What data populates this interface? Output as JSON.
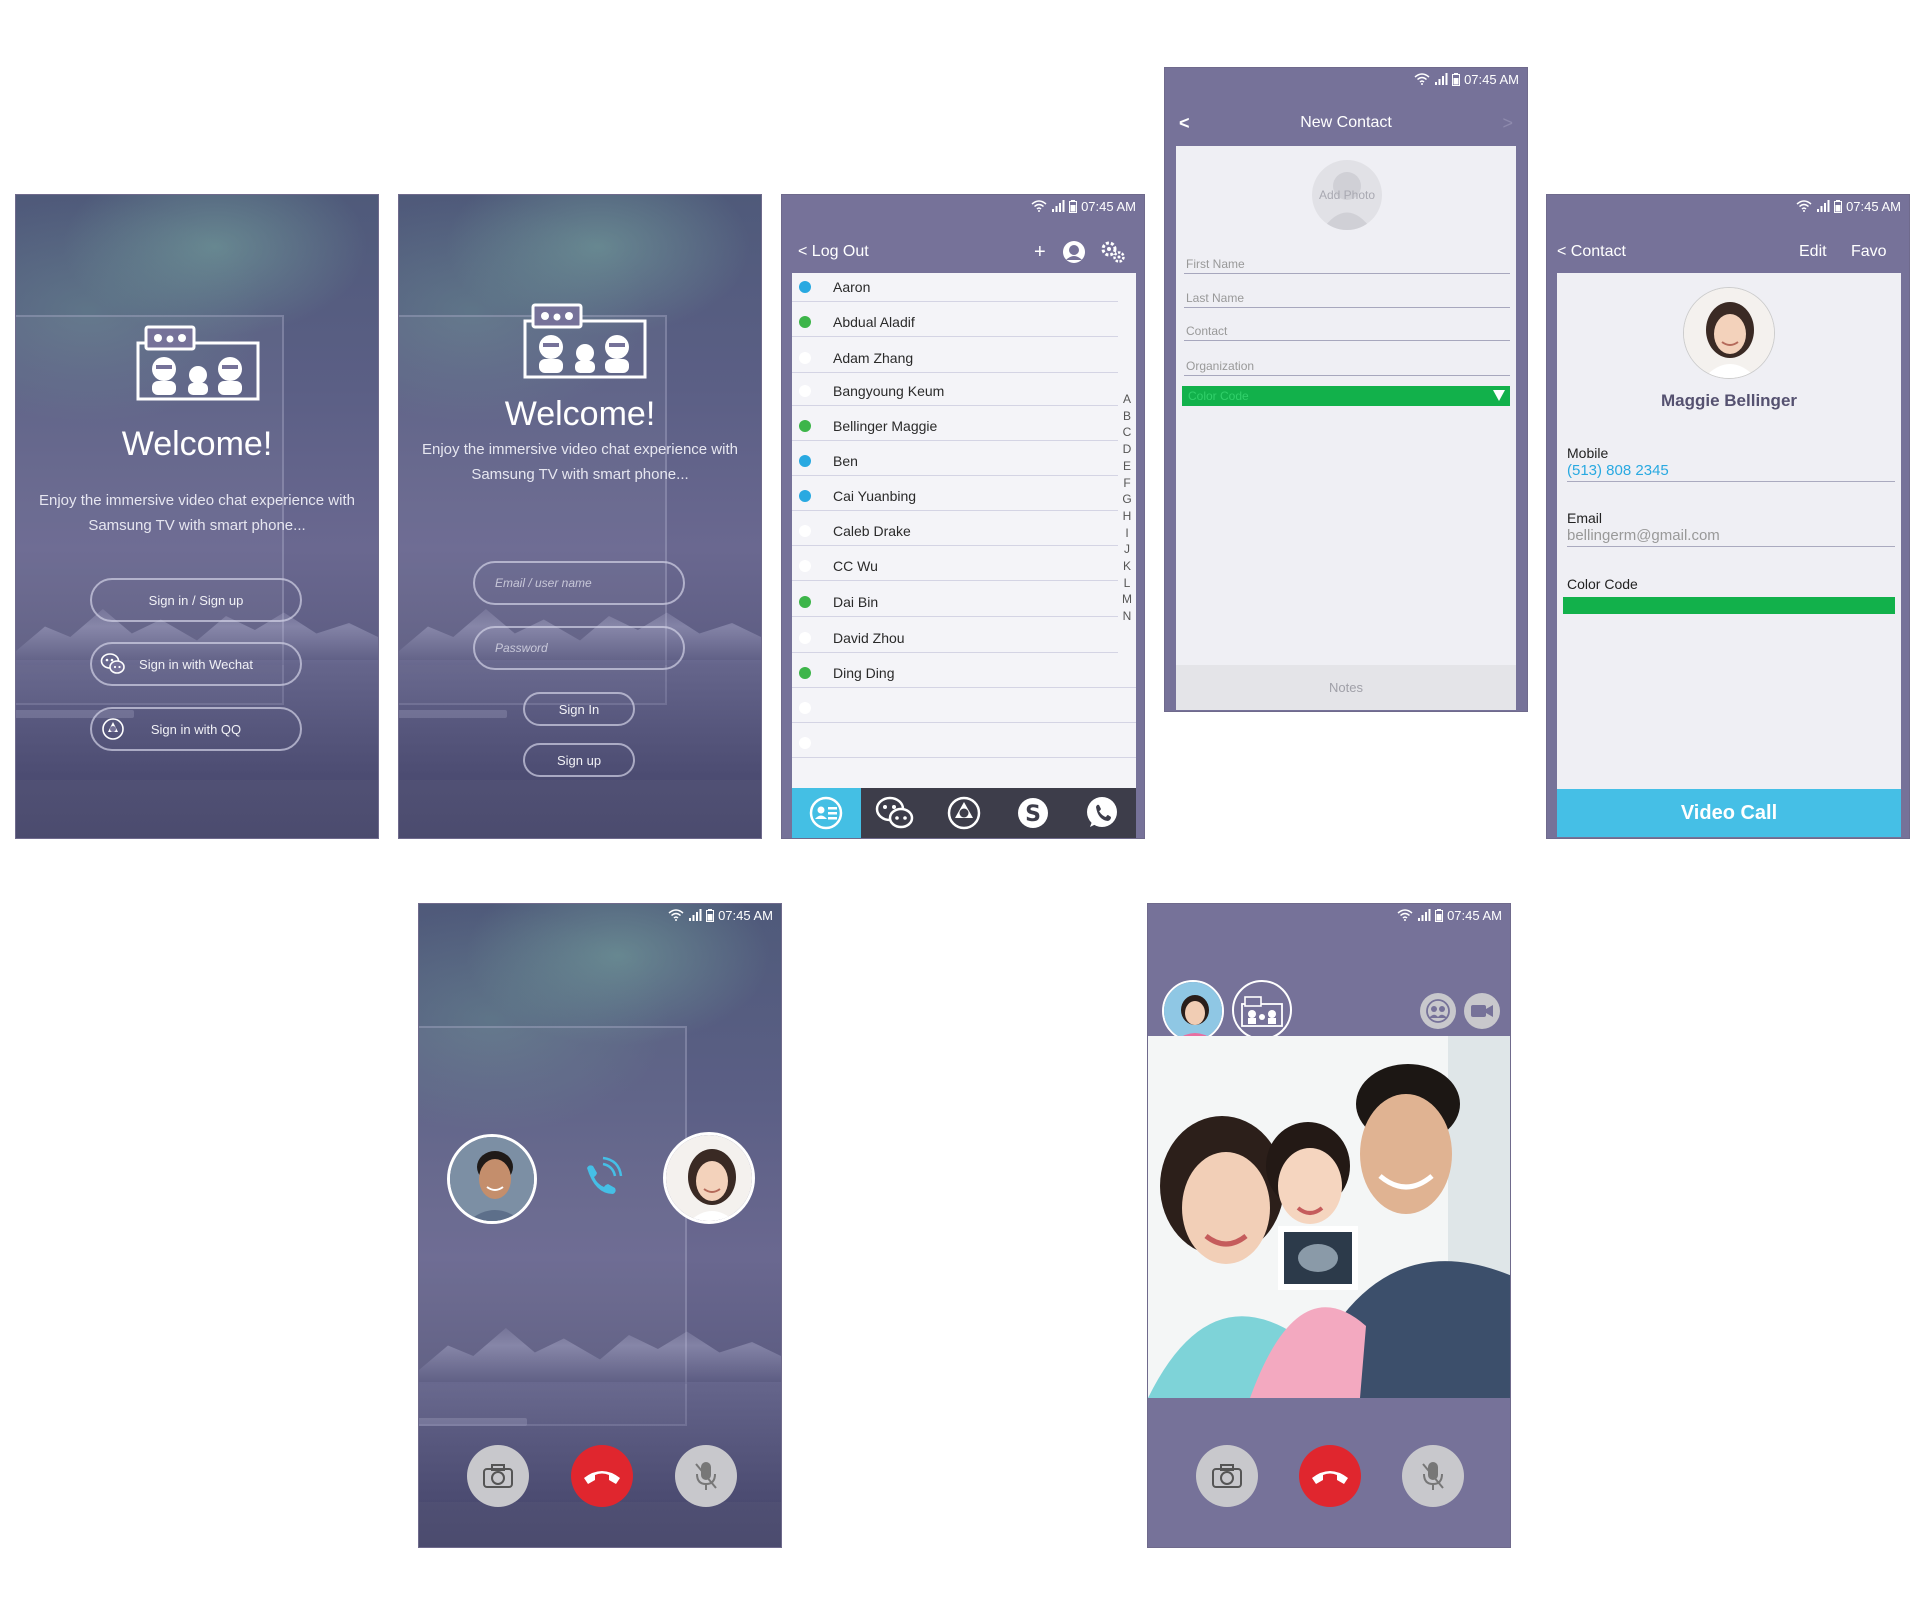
{
  "status": {
    "time": "07:45 AM"
  },
  "welcome1": {
    "title": "Welcome!",
    "tagline": "Enjoy the immersive video chat experience with Samsung TV with smart phone...",
    "signin_signup": "Sign in / Sign up",
    "wechat": "Sign in with Wechat",
    "qq": "Sign in with QQ"
  },
  "welcome2": {
    "title": "Welcome!",
    "tagline": "Enjoy the immersive video chat experience with Samsung TV with smart phone...",
    "email_placeholder": "Email / user name",
    "password_placeholder": "Password",
    "sign_in": "Sign In",
    "sign_up": "Sign up"
  },
  "contacts": {
    "back_label": "< Log Out",
    "add": "+",
    "rows": [
      {
        "name": "Aaron",
        "dot": "#29a9e1"
      },
      {
        "name": "Abdual Aladif",
        "dot": "#3db54a"
      },
      {
        "name": "Adam Zhang",
        "dot": "#ffffff"
      },
      {
        "name": "Bangyoung Keum",
        "dot": "#ffffff"
      },
      {
        "name": "Bellinger Maggie",
        "dot": "#3db54a"
      },
      {
        "name": "Ben",
        "dot": "#29a9e1"
      },
      {
        "name": "Cai Yuanbing",
        "dot": "#29a9e1"
      },
      {
        "name": "Caleb Drake",
        "dot": "#ffffff"
      },
      {
        "name": "CC Wu",
        "dot": "#ffffff"
      },
      {
        "name": "Dai Bin",
        "dot": "#3db54a"
      },
      {
        "name": "David Zhou",
        "dot": "#ffffff"
      },
      {
        "name": "Ding Ding",
        "dot": "#3db54a"
      },
      {
        "name": "",
        "dot": "#ffffff"
      },
      {
        "name": "",
        "dot": "#ffffff"
      }
    ],
    "alphabet": [
      "A",
      "B",
      "C",
      "D",
      "E",
      "F",
      "G",
      "H",
      "I",
      "J",
      "K",
      "L",
      "M",
      "N"
    ]
  },
  "new_contact": {
    "back": "<",
    "title": "New Contact",
    "next": ">",
    "add_photo": "Add Photo",
    "first_name": "First Name",
    "last_name": "Last Name",
    "contact": "Contact",
    "organization": "Organization",
    "color_code": "Color Code",
    "color_value": "#12b14b",
    "notes": "Notes"
  },
  "contact_detail": {
    "back_label": "< Contact",
    "edit": "Edit",
    "favo": "Favo",
    "name": "Maggie Bellinger",
    "mobile_label": "Mobile",
    "mobile": "(513) 808 2345",
    "email_label": "Email",
    "email": "bellingerm@gmail.com",
    "color_label": "Color Code",
    "color_value": "#12b14b",
    "video_call": "Video Call"
  },
  "colors": {
    "header_purple": "#767299",
    "accent_blue": "#45bfe6",
    "hangup_red": "#e0262e",
    "green": "#12b14b"
  }
}
